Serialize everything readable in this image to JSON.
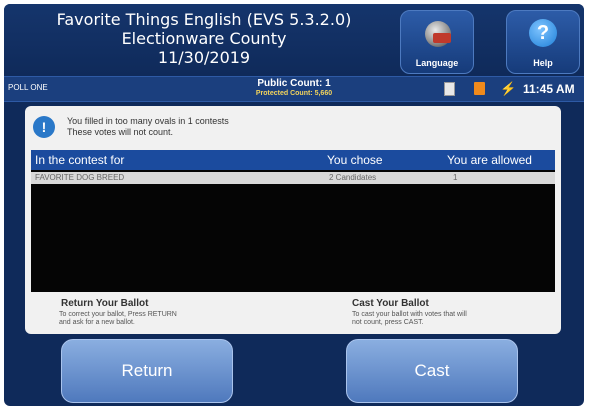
{
  "header": {
    "title": "Favorite Things English (EVS 5.3.2.0)",
    "county": "Electionware County",
    "date": "11/30/2019",
    "language_label": "Language",
    "help_label": "Help",
    "help_glyph": "?"
  },
  "status": {
    "poll": "POLL ONE",
    "public_count": "Public Count: 1",
    "protected_count": "Protected Count: 5,660",
    "time": "11:45 AM"
  },
  "message": {
    "info_glyph": "!",
    "line1": "You filled in too many ovals in 1 contests",
    "line2": "These votes will not count."
  },
  "table": {
    "headers": [
      "In the contest for",
      "You chose",
      "You are allowed"
    ],
    "rows": [
      [
        "FAVORITE DOG BREED",
        "2 Candidates",
        "1"
      ]
    ]
  },
  "return_section": {
    "title": "Return Your Ballot",
    "text_line1": "To correct your ballot, Press RETURN",
    "text_line2": "and ask for a new ballot."
  },
  "cast_section": {
    "title": "Cast Your Ballot",
    "text_line1": "To cast your ballot with votes that will",
    "text_line2": "not count, press CAST."
  },
  "buttons": {
    "return_label": "Return",
    "cast_label": "Cast"
  },
  "icons": {
    "language": "globe-icon",
    "help": "help-icon",
    "document": "document-icon",
    "save": "save-icon",
    "power": "plug-icon",
    "info": "info-icon"
  },
  "colors": {
    "background": "#0f2a5a",
    "table_header": "#1b4b9e",
    "button": "#6b93d0",
    "protected_count": "#f2d35c"
  }
}
